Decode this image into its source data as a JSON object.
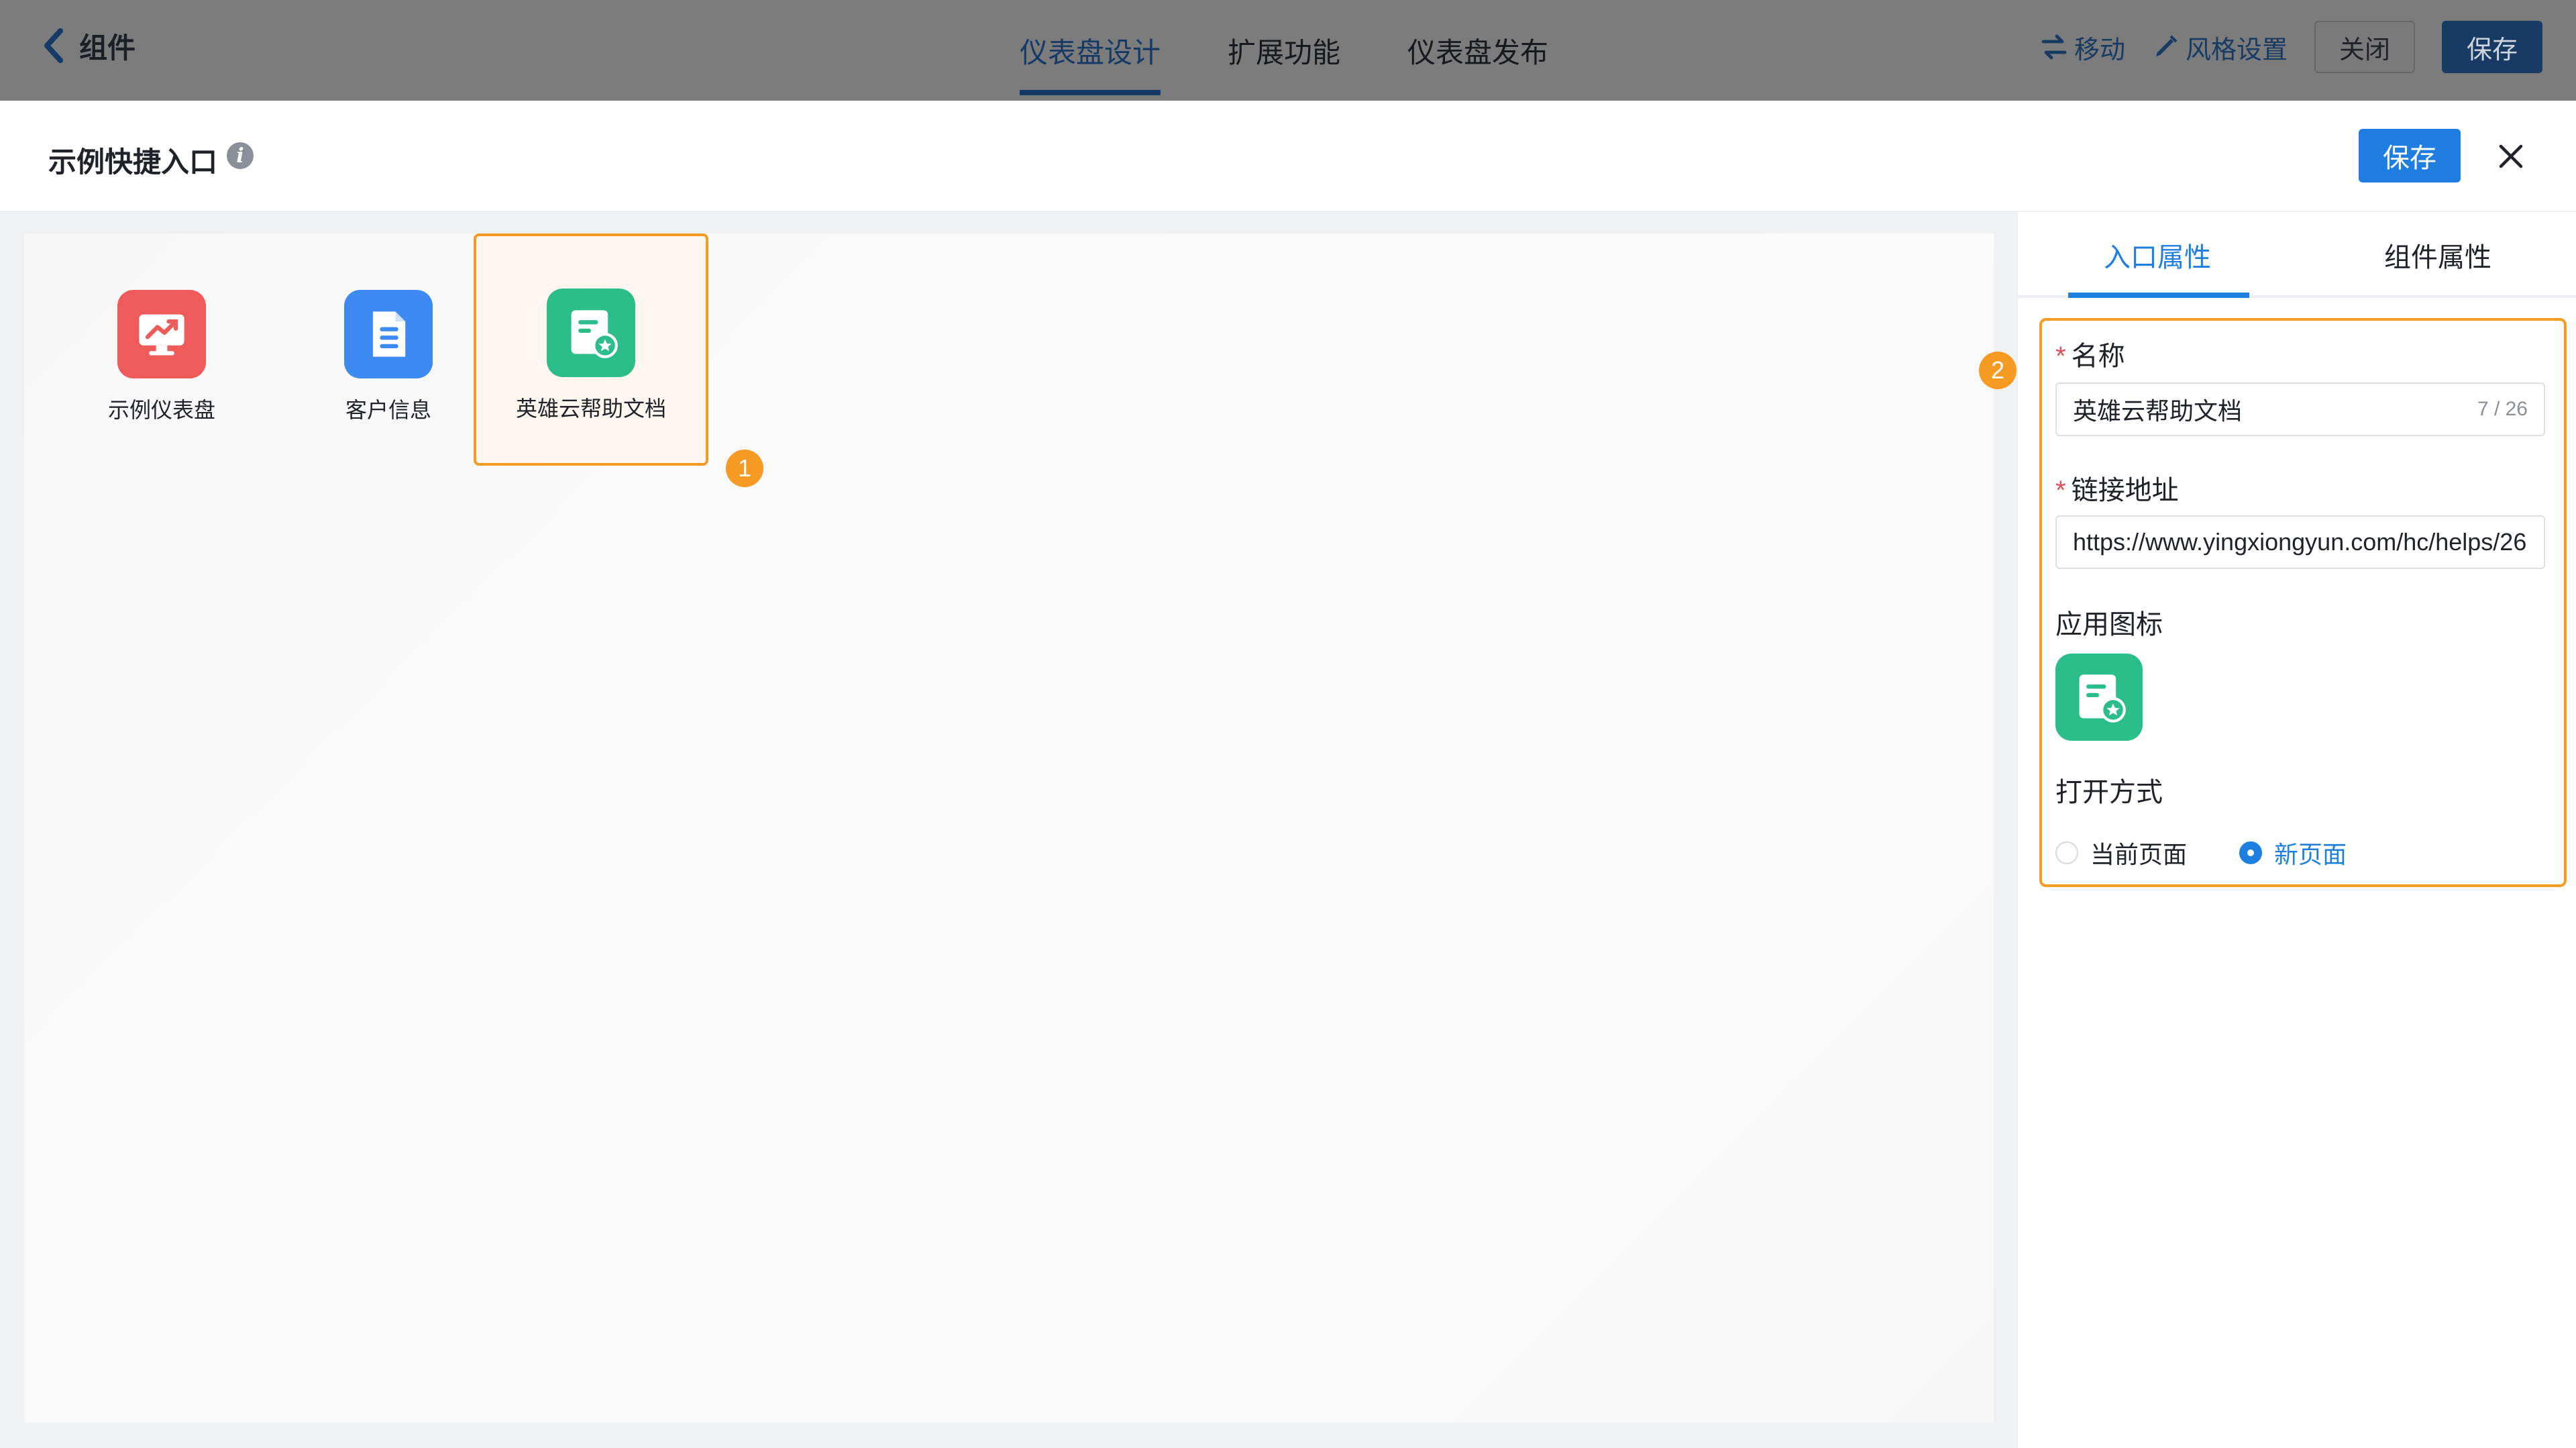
{
  "topbar": {
    "back_label": "组件",
    "tabs": [
      {
        "label": "仪表盘设计",
        "active": true
      },
      {
        "label": "扩展功能",
        "active": false
      },
      {
        "label": "仪表盘发布",
        "active": false
      }
    ],
    "actions": {
      "move_label": "移动",
      "style_label": "风格设置",
      "close_label": "关闭",
      "save_label": "保存"
    }
  },
  "modal": {
    "title": "示例快捷入口",
    "save_label": "保存",
    "info_glyph": "i"
  },
  "apps": [
    {
      "label": "示例仪表盘",
      "icon": "chart-trend-icon",
      "color": "#ef5a5a"
    },
    {
      "label": "客户信息",
      "icon": "document-icon",
      "color": "#3d8bf2"
    },
    {
      "label": "英雄云帮助文档",
      "icon": "doc-star-icon",
      "color": "#2bbd8a",
      "selected": true
    }
  ],
  "badges": {
    "one": "1",
    "two": "2"
  },
  "panel": {
    "tabs": [
      {
        "label": "入口属性",
        "active": true
      },
      {
        "label": "组件属性",
        "active": false
      }
    ],
    "name_label": "名称",
    "name_required": "*",
    "name_value": "英雄云帮助文档",
    "name_count": "7 / 26",
    "link_label": "链接地址",
    "link_required": "*",
    "link_value": "https://www.yingxiongyun.com/hc/helps/26",
    "icon_label": "应用图标",
    "open_label": "打开方式",
    "open_options": [
      {
        "label": "当前页面",
        "checked": false
      },
      {
        "label": "新页面",
        "checked": true
      }
    ]
  },
  "colors": {
    "accent": "#1e7fe0",
    "highlight": "#f59a23",
    "topbar_dim": "#7c7c7c"
  }
}
